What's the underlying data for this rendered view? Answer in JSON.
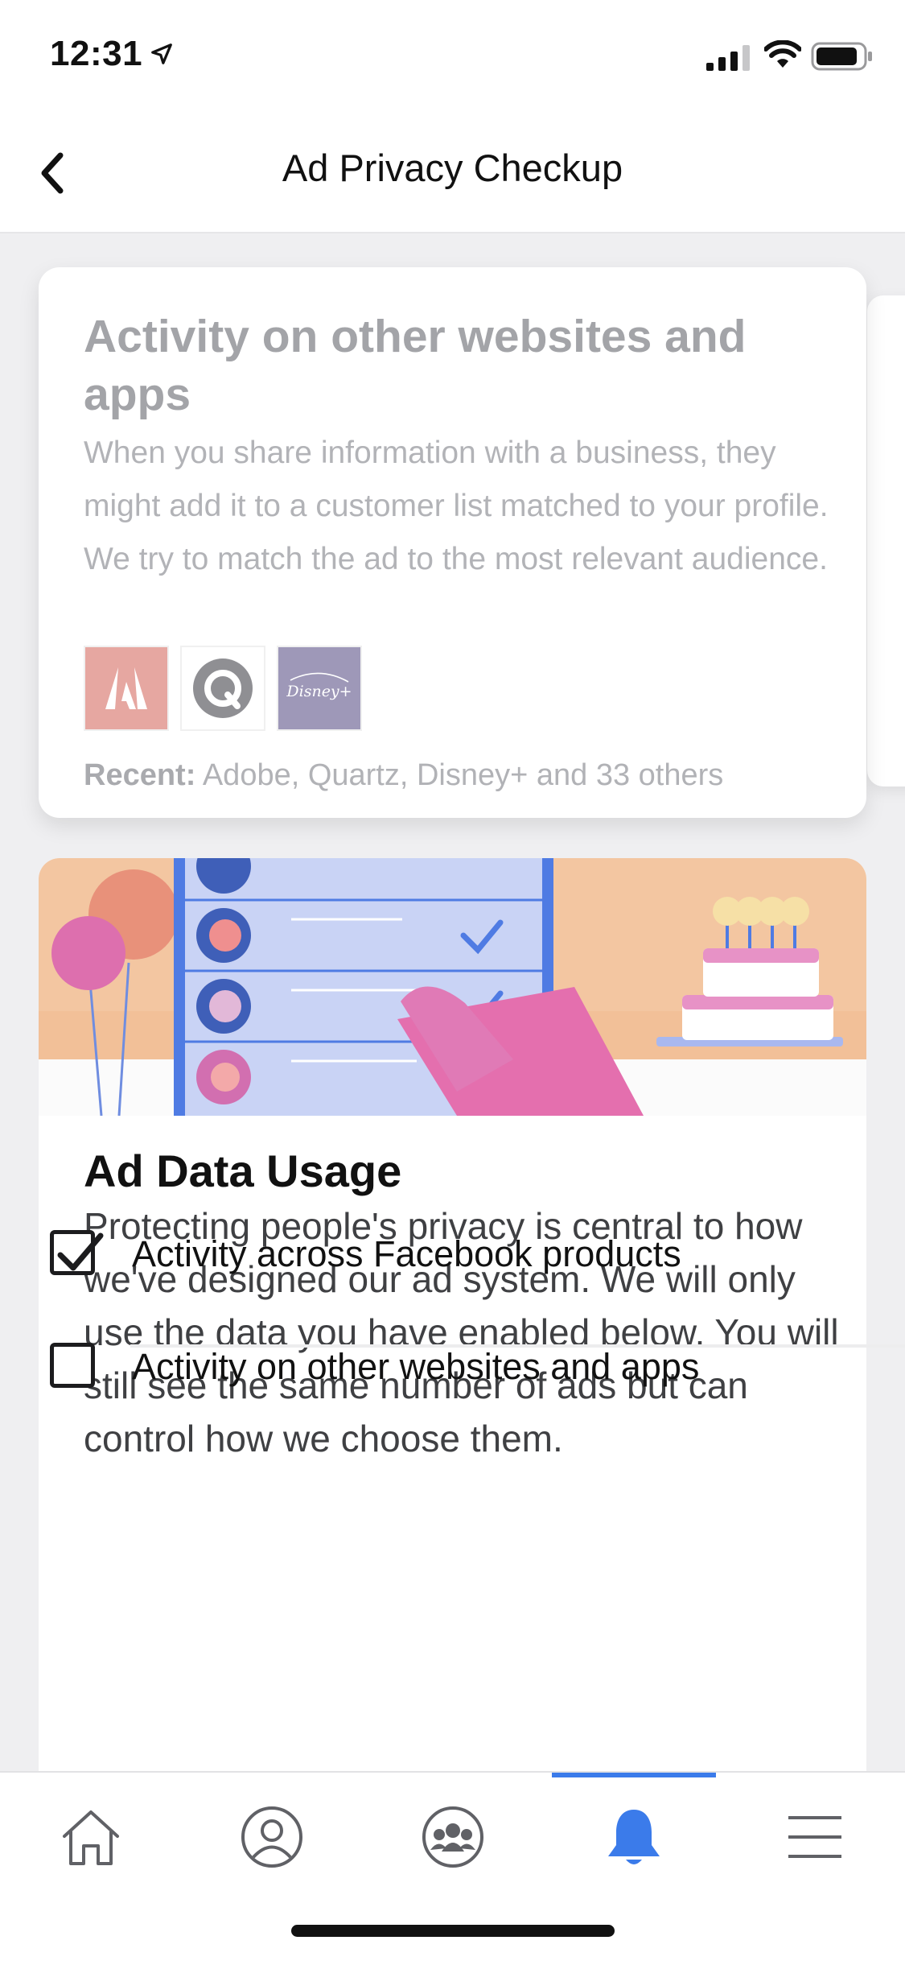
{
  "status_bar": {
    "time": "12:31"
  },
  "nav": {
    "title": "Ad Privacy Checkup"
  },
  "card_previous": {
    "title": "Activity on other websites and apps",
    "description": "When you share information with a business, they might add it to a customer list matched to your profile. We try to match the ad to the most relevant audience.",
    "logos": [
      {
        "name": "adobe-logo",
        "label": "Adobe"
      },
      {
        "name": "quartz-logo",
        "label": "Quartz"
      },
      {
        "name": "disney-plus-logo",
        "label": "Disney+"
      }
    ],
    "recent_label": "Recent:",
    "recent_text": " Adobe, Quartz, Disney+ and 33 others"
  },
  "card_main": {
    "title": "Ad Data Usage",
    "description": "Protecting people's privacy is central to how we've designed our ad system. We will only use the data you have enabled below. You will still see the same number of ads but can control how we choose them.",
    "options": [
      {
        "label": "Activity across Facebook products",
        "checked": true
      },
      {
        "label": "Activity on other websites and apps",
        "checked": false
      }
    ]
  },
  "tab_bar": {
    "tabs": [
      {
        "name": "home",
        "icon": "home-icon"
      },
      {
        "name": "profile",
        "icon": "profile-icon"
      },
      {
        "name": "groups",
        "icon": "groups-icon"
      },
      {
        "name": "notifications",
        "icon": "bell-icon",
        "active": true
      },
      {
        "name": "menu",
        "icon": "menu-icon"
      }
    ]
  },
  "colors": {
    "accent": "#3b7bea",
    "hero_background": "#f3c6a1",
    "pink": "#e07ab6"
  }
}
